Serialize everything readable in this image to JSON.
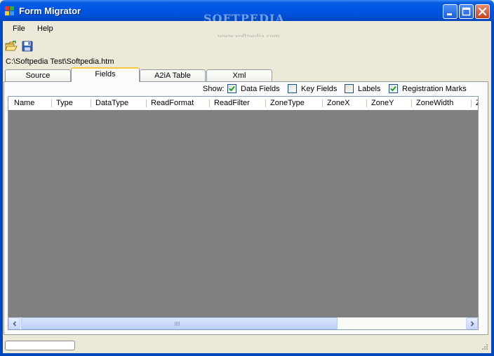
{
  "window": {
    "title": "Form Migrator",
    "watermark": "SOFTPEDIA",
    "watermark_sub": "www.softpedia.com"
  },
  "menu": {
    "items": [
      {
        "label": "File"
      },
      {
        "label": "Help"
      }
    ]
  },
  "toolbar": {
    "buttons": [
      {
        "icon": "open-folder-icon"
      },
      {
        "icon": "save-icon"
      }
    ]
  },
  "path": "C:\\Softpedia Test\\Softpedia.htm",
  "tabs": [
    {
      "label": "Source",
      "active": false
    },
    {
      "label": "Fields",
      "active": true
    },
    {
      "label": "A2iA Table",
      "active": false
    },
    {
      "label": "Xml",
      "active": false
    }
  ],
  "show": {
    "label": "Show:",
    "options": [
      {
        "label": "Data Fields",
        "checked": true
      },
      {
        "label": "Key Fields",
        "checked": false
      },
      {
        "label": "Labels",
        "checked": false
      },
      {
        "label": "Registration Marks",
        "checked": true
      }
    ]
  },
  "grid": {
    "columns": [
      "Name",
      "Type",
      "DataType",
      "ReadFormat",
      "ReadFilter",
      "ZoneType",
      "ZoneX",
      "ZoneY",
      "ZoneWidth",
      "Z"
    ],
    "rows": []
  },
  "colors": {
    "titlebar": "#0055e5",
    "grid_background": "#808080",
    "active_tab_accent": "#ffc83c",
    "check_mark": "#21a121"
  }
}
